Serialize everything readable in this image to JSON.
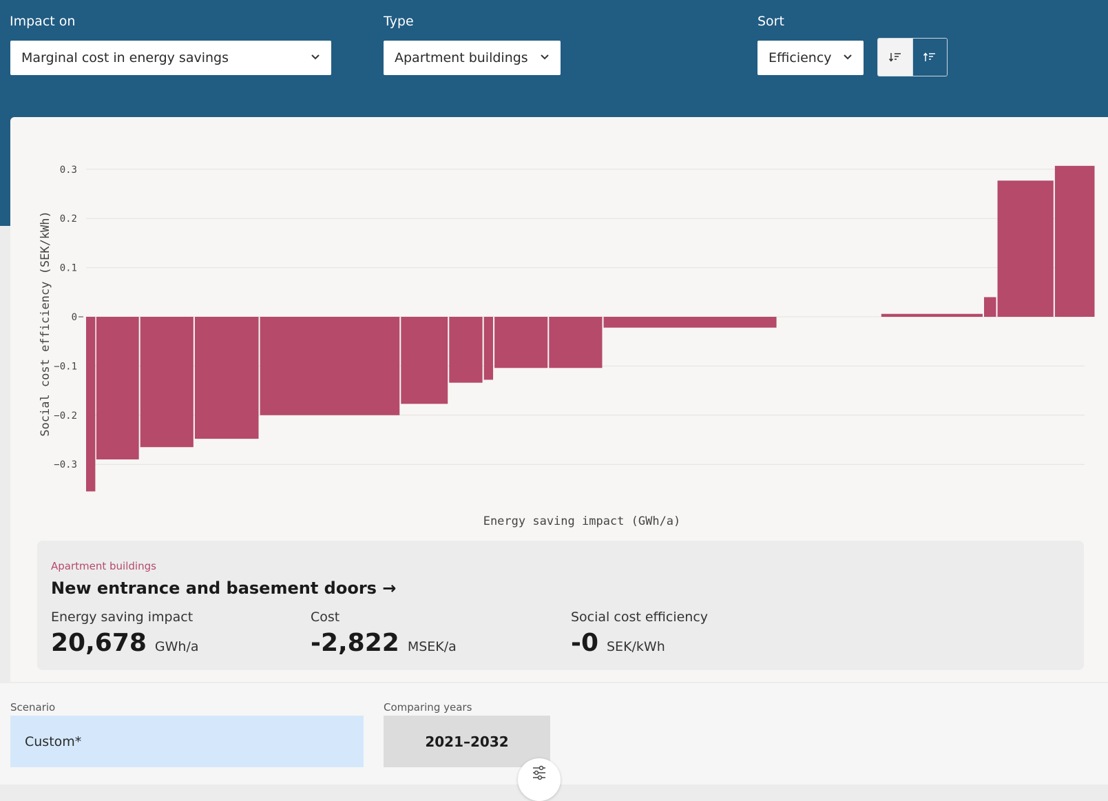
{
  "filters": {
    "impact": {
      "label": "Impact on",
      "value": "Marginal cost in energy savings"
    },
    "type": {
      "label": "Type",
      "value": "Apartment buildings"
    },
    "sort": {
      "label": "Sort",
      "value": "Efficiency"
    }
  },
  "chart_data": {
    "type": "bar",
    "variable_width": true,
    "ylabel": "Social cost efficiency (SEK/kWh)",
    "xlabel": "Energy saving impact (GWh/a)",
    "ylim": [
      -0.36,
      0.32
    ],
    "yticks": [
      {
        "value": 0.3,
        "label": "0.3"
      },
      {
        "value": 0.2,
        "label": "0.2"
      },
      {
        "value": 0.1,
        "label": "0.1"
      },
      {
        "value": 0,
        "label": "0"
      },
      {
        "value": -0.1,
        "label": "−0.1"
      },
      {
        "value": -0.2,
        "label": "−0.2"
      },
      {
        "value": -0.3,
        "label": "−0.3"
      }
    ],
    "grid": true,
    "color": "#b54a6b",
    "bars": [
      {
        "start": 0,
        "width": 13,
        "value": -0.355
      },
      {
        "start": 14.5,
        "width": 60,
        "value": -0.29
      },
      {
        "start": 76.5,
        "width": 75,
        "value": -0.265
      },
      {
        "start": 153.5,
        "width": 90,
        "value": -0.248
      },
      {
        "start": 245.5,
        "width": 197,
        "value": -0.2
      },
      {
        "start": 444.5,
        "width": 66,
        "value": -0.177
      },
      {
        "start": 512.5,
        "width": 47,
        "value": -0.134
      },
      {
        "start": 561.5,
        "width": 13,
        "value": -0.128
      },
      {
        "start": 576.5,
        "width": 75,
        "value": -0.104
      },
      {
        "start": 653.5,
        "width": 75,
        "value": -0.104
      },
      {
        "start": 730.5,
        "width": 244,
        "value": -0.022
      },
      {
        "start": 1122.5,
        "width": 143,
        "value": 0.006
      },
      {
        "start": 1267.5,
        "width": 17,
        "value": 0.04
      },
      {
        "start": 1286.5,
        "width": 79,
        "value": 0.277
      },
      {
        "start": 1367.5,
        "width": 56,
        "value": 0.307
      }
    ],
    "xlim": [
      0,
      1424
    ]
  },
  "info": {
    "category": "Apartment buildings",
    "title": "New entrance and basement doors →",
    "metrics": [
      {
        "label": "Energy saving impact",
        "value": "20,678",
        "unit": "GWh/a"
      },
      {
        "label": "Cost",
        "value": "-2,822",
        "unit": "MSEK/a"
      },
      {
        "label": "Social cost efficiency",
        "value": "-0",
        "unit": "SEK/kWh"
      }
    ]
  },
  "bottom": {
    "scenario_label": "Scenario",
    "scenario_value": "Custom*",
    "years_label": "Comparing years",
    "years_value": "2021–2032"
  },
  "icons": {
    "chevron": "chevron-down-icon",
    "sort_desc": "sort-descending-icon",
    "sort_asc": "sort-ascending-icon",
    "filter": "sliders-icon"
  }
}
